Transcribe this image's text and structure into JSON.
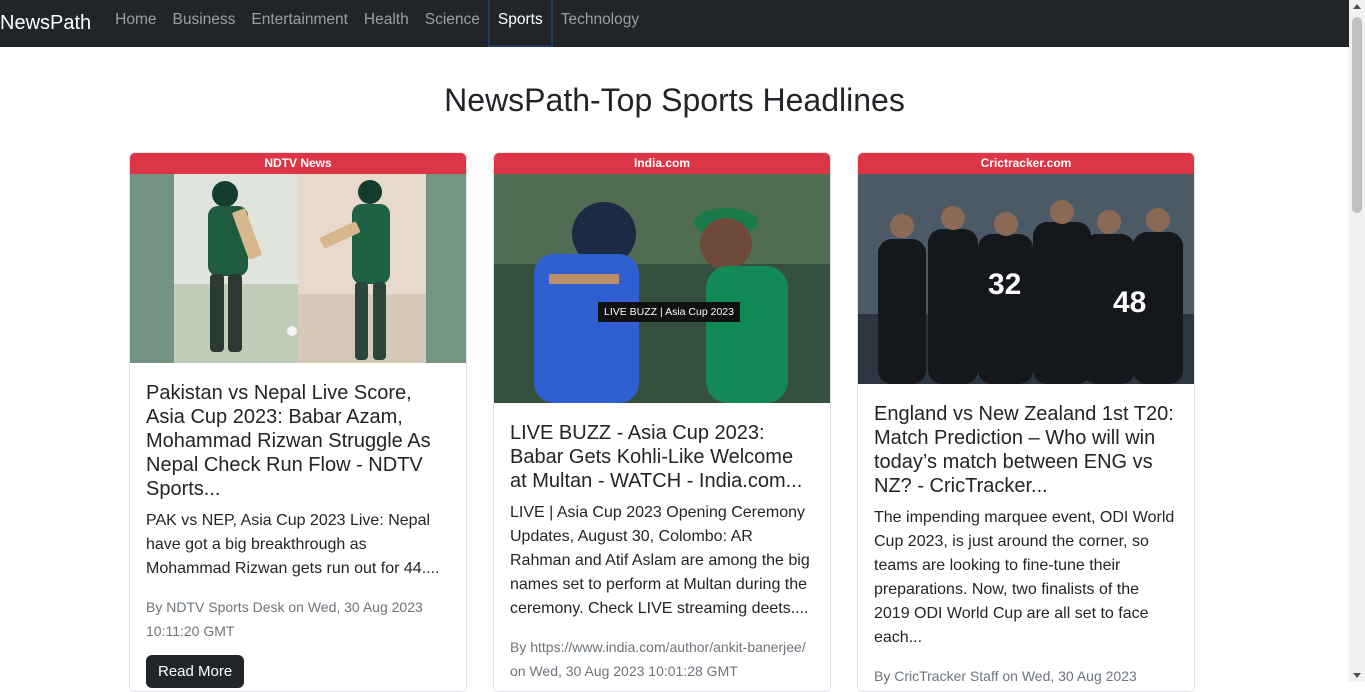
{
  "navbar": {
    "brand": "NewsPath",
    "items": [
      {
        "label": "Home"
      },
      {
        "label": "Business"
      },
      {
        "label": "Entertainment"
      },
      {
        "label": "Health"
      },
      {
        "label": "Science"
      },
      {
        "label": "Sports"
      },
      {
        "label": "Technology"
      }
    ],
    "active": "Sports"
  },
  "page": {
    "title": "NewsPath-Top Sports Headlines"
  },
  "articles": [
    {
      "source": "NDTV News",
      "title": "Pakistan vs Nepal Live Score, Asia Cup 2023: Babar Azam, Mohammad Rizwan Struggle As Nepal Check Run Flow - NDTV Sports...",
      "description": "PAK vs NEP, Asia Cup 2023 Live: Nepal have got a big breakthrough as Mohammad Rizwan gets run out for 44....",
      "meta": "By NDTV Sports Desk on Wed, 30 Aug 2023 10:11:20 GMT",
      "button": "Read More"
    },
    {
      "source": "India.com",
      "image_caption": "LIVE BUZZ | Asia Cup 2023",
      "title": "LIVE BUZZ - Asia Cup 2023: Babar Gets Kohli-Like Welcome at Multan - WATCH - India.com...",
      "description": "LIVE | Asia Cup 2023 Opening Ceremony Updates, August 30, Colombo: AR Rahman and Atif Aslam are among the big names set to perform at Multan during the ceremony. Check LIVE streaming deets....",
      "meta": "By https://www.india.com/author/ankit-banerjee/ on Wed, 30 Aug 2023 10:01:28 GMT"
    },
    {
      "source": "Crictracker.com",
      "title": "England vs New Zealand 1st T20: Match Prediction – Who will win today’s match between ENG vs NZ? - CricTracker...",
      "description": "The impending marquee event, ODI World Cup 2023, is just around the corner, so teams are looking to fine-tune their preparations. Now, two finalists of the 2019 ODI World Cup are all set to face each...",
      "meta": "By CricTracker Staff on Wed, 30 Aug 2023"
    }
  ],
  "colors": {
    "navbar": "#212529",
    "badge": "#dc3545",
    "button": "#212529"
  }
}
